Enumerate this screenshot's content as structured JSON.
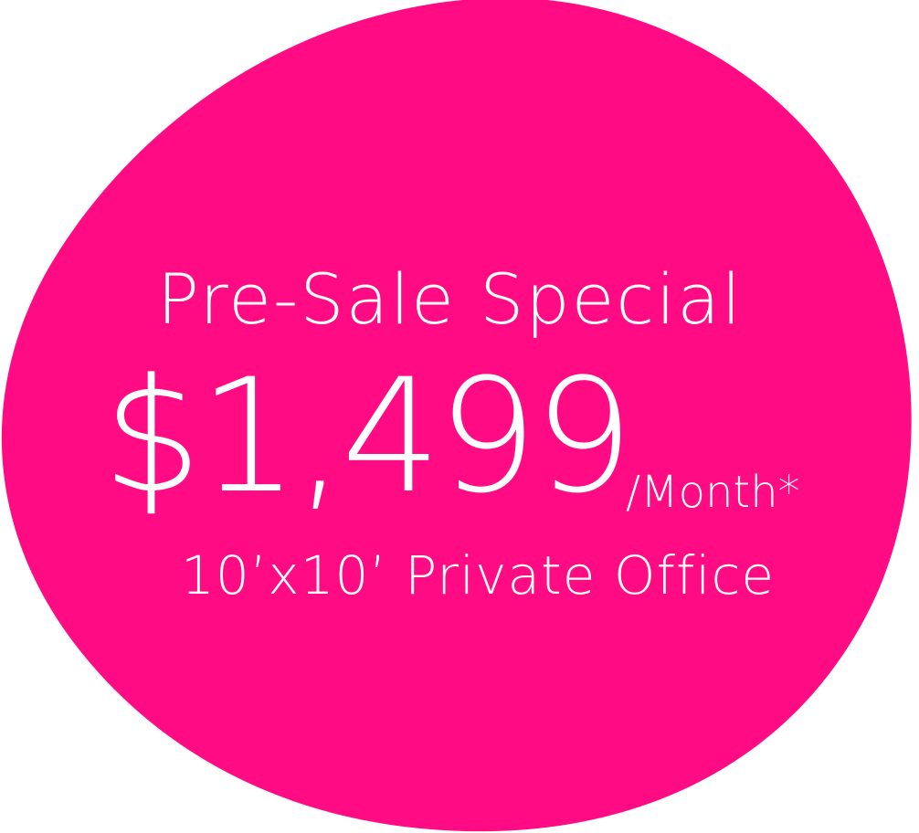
{
  "promo": {
    "headline": "Pre-Sale Special",
    "price": "$1,499",
    "period": "/Month*",
    "subtitle": "10’x10’ Private Office"
  },
  "colors": {
    "blob": "#ff0b84",
    "text": "#ffffff",
    "background": "#ffffff"
  }
}
